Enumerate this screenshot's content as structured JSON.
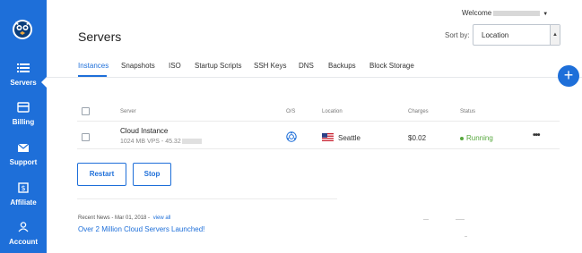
{
  "sidebar": {
    "items": [
      {
        "label": "Servers",
        "icon": "list-icon",
        "active": true
      },
      {
        "label": "Billing",
        "icon": "credit-card-icon"
      },
      {
        "label": "Support",
        "icon": "envelope-icon"
      },
      {
        "label": "Affiliate",
        "icon": "dollar-icon"
      },
      {
        "label": "Account",
        "icon": "user-icon"
      }
    ],
    "color": "#1e6fd9"
  },
  "header": {
    "welcome": "Welcome",
    "title": "Servers",
    "sort_label": "Sort by:",
    "sort_value": "Location"
  },
  "tabs": [
    "Instances",
    "Snapshots",
    "ISO",
    "Startup Scripts",
    "SSH Keys",
    "DNS",
    "Backups",
    "Block Storage"
  ],
  "table": {
    "headers": [
      "Server",
      "O/S",
      "Location",
      "Charges",
      "Status"
    ],
    "rows": [
      {
        "name": "Cloud Instance",
        "meta": "1024 MB VPS - 45.32",
        "os_icon": "os-logo-icon",
        "flag": "us-flag-icon",
        "location": "Seattle",
        "charges": "$0.02",
        "status": "Running",
        "more": "•••"
      }
    ]
  },
  "actions": {
    "restart": "Restart",
    "stop": "Stop"
  },
  "news": {
    "meta": "Recent News - Mar 01, 2018 -",
    "view_all": "view all",
    "headline": "Over 2 Million Cloud Servers Launched!"
  },
  "fab_label": "+",
  "colors": {
    "accent": "#1e6fd9",
    "running": "#57a83e"
  }
}
